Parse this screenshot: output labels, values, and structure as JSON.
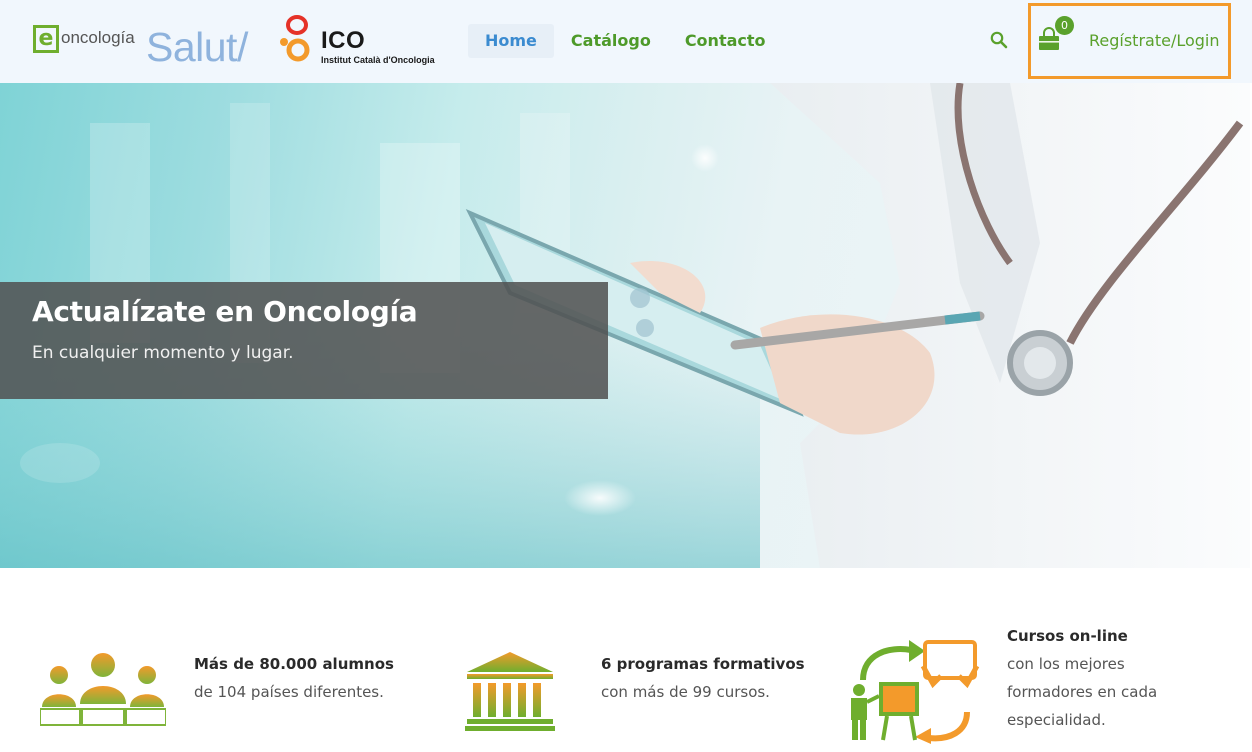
{
  "header": {
    "logo_e_letter": "e",
    "logo_e_text": "oncología",
    "logo_salut": "Salut/",
    "logo_ico_title": "ICO",
    "logo_ico_subtitle": "Institut Català d'Oncologia",
    "nav": [
      {
        "label": "Home",
        "active": true
      },
      {
        "label": "Catálogo",
        "active": false
      },
      {
        "label": "Contacto",
        "active": false
      }
    ],
    "cart_count": "0",
    "login_label": "Regístrate/Login",
    "icons": [
      "search-icon",
      "shopping-bag-icon"
    ]
  },
  "hero": {
    "title": "Actualízate en Oncología",
    "subtitle": "En cualquier momento y lugar."
  },
  "features": [
    {
      "icon": "students-icon",
      "title": "Más de 80.000 alumnos",
      "lines": [
        "de 104 países diferentes."
      ]
    },
    {
      "icon": "institution-icon",
      "title": "6 programas formativos",
      "lines": [
        "con más de 99 cursos."
      ]
    },
    {
      "icon": "online-teaching-icon",
      "title": "Cursos on-line",
      "lines": [
        "con los mejores",
        "formadores en cada",
        "especialidad."
      ]
    }
  ],
  "colors": {
    "brand_green": "#5aa12c",
    "link_blue": "#3b8bd0",
    "header_bg": "#f1f7fd",
    "highlight_orange": "#f39a2b",
    "icon_orange": "#f39a2b"
  }
}
